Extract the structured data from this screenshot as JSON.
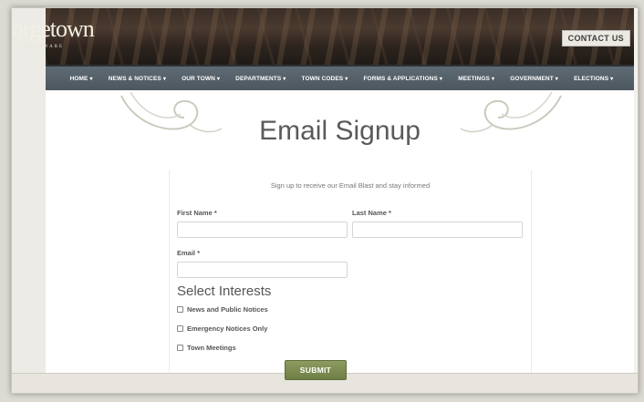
{
  "header": {
    "logo_text": "orgetown",
    "logo_sub": "DELAWARE",
    "contact_label": "CONTACT US"
  },
  "nav": {
    "items": [
      {
        "label": "HOME"
      },
      {
        "label": "NEWS & NOTICES"
      },
      {
        "label": "OUR TOWN"
      },
      {
        "label": "DEPARTMENTS"
      },
      {
        "label": "TOWN CODES"
      },
      {
        "label": "FORMS & APPLICATIONS"
      },
      {
        "label": "MEETINGS"
      },
      {
        "label": "GOVERNMENT"
      },
      {
        "label": "ELECTIONS"
      }
    ],
    "caret": "▾"
  },
  "page": {
    "title": "Email Signup"
  },
  "form": {
    "intro": "Sign up to receive our Email Blast and stay informed",
    "first_name_label": "First Name *",
    "last_name_label": "Last Name *",
    "email_label": "Email *",
    "first_name_value": "",
    "last_name_value": "",
    "email_value": "",
    "interests_heading": "Select Interests",
    "interests": [
      {
        "label": "News and Public Notices",
        "checked": false
      },
      {
        "label": "Emergency Notices Only",
        "checked": false
      },
      {
        "label": "Town Meetings",
        "checked": false
      }
    ],
    "submit_label": "SUBMIT"
  },
  "colors": {
    "navbar": "#55616a",
    "submit": "#7b8a4f",
    "title": "#5a5a5a"
  }
}
